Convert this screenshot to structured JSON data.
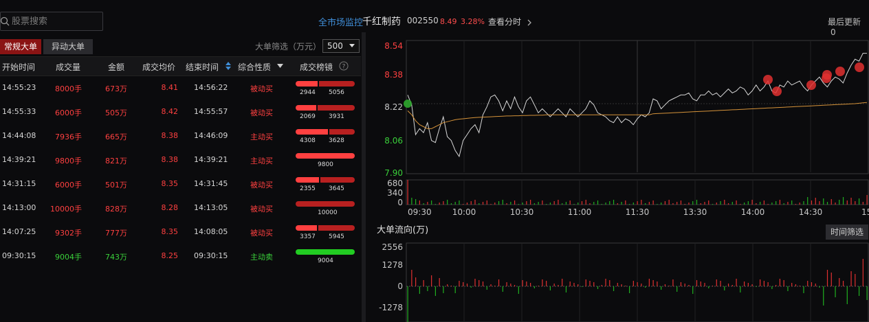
{
  "search": {
    "placeholder": "股票搜索"
  },
  "header": {
    "market_monitor": "全市场监控",
    "stock_name": "千红制药",
    "stock_code": "002550",
    "price": "8.49",
    "change_pct": "3.28%",
    "view_timeshare": "查看分时",
    "last_update_label": "最后更新",
    "last_update_value": "0"
  },
  "tabs": [
    {
      "label": "常规大单"
    },
    {
      "label": "异动大单"
    }
  ],
  "filter": {
    "label": "大单筛选（万元）",
    "value": "500"
  },
  "table": {
    "headers": [
      "开始时间",
      "成交量",
      "金额",
      "成交均价",
      "结束时间",
      "综合性质",
      "成交榜镜"
    ],
    "rows": [
      {
        "start": "14:55:23",
        "vol": "8000手",
        "amt": "673万",
        "avg": "8.41",
        "end": "14:56:22",
        "nature": "被动买",
        "buy": 2944,
        "sell": 5056,
        "buy_label": "2944",
        "sell_label": "5056",
        "dir": "buy"
      },
      {
        "start": "14:55:33",
        "vol": "6000手",
        "amt": "505万",
        "avg": "8.42",
        "end": "14:55:57",
        "nature": "被动买",
        "buy": 2069,
        "sell": 3931,
        "buy_label": "2069",
        "sell_label": "3931",
        "dir": "buy"
      },
      {
        "start": "14:44:08",
        "vol": "7936手",
        "amt": "665万",
        "avg": "8.38",
        "end": "14:46:09",
        "nature": "主动买",
        "buy": 4308,
        "sell": 3628,
        "buy_label": "4308",
        "sell_label": "3628",
        "dir": "buy"
      },
      {
        "start": "14:39:21",
        "vol": "9800手",
        "amt": "821万",
        "avg": "8.38",
        "end": "14:39:21",
        "nature": "主动买",
        "buy": 9800,
        "sell": 0,
        "buy_label": "9800",
        "sell_label": "",
        "dir": "buy"
      },
      {
        "start": "14:31:15",
        "vol": "6000手",
        "amt": "501万",
        "avg": "8.35",
        "end": "14:31:45",
        "nature": "被动买",
        "buy": 2355,
        "sell": 3645,
        "buy_label": "2355",
        "sell_label": "3645",
        "dir": "buy"
      },
      {
        "start": "14:13:00",
        "vol": "10000手",
        "amt": "828万",
        "avg": "8.28",
        "end": "14:13:05",
        "nature": "被动买",
        "buy": 0,
        "sell": 10000,
        "buy_label": "",
        "sell_label": "10000",
        "dir": "buy"
      },
      {
        "start": "14:07:25",
        "vol": "9302手",
        "amt": "777万",
        "avg": "8.35",
        "end": "14:08:05",
        "nature": "被动买",
        "buy": 3357,
        "sell": 5945,
        "buy_label": "3357",
        "sell_label": "5945",
        "dir": "buy"
      },
      {
        "start": "09:30:15",
        "vol": "9004手",
        "amt": "743万",
        "avg": "8.25",
        "end": "09:30:15",
        "nature": "主动卖",
        "buy": 9004,
        "sell": 0,
        "buy_label": "9004",
        "sell_label": "",
        "dir": "sell"
      }
    ]
  },
  "price_chart": {
    "y_ticks": [
      "8.54",
      "8.38",
      "8.22",
      "8.06",
      "7.90"
    ],
    "y_colors": [
      "#ff4040",
      "#ff4040",
      "#c8c8c8",
      "#3ad13a",
      "#3ad13a"
    ],
    "price_series": [
      8.29,
      8.24,
      8.09,
      8.12,
      8.1,
      8.15,
      8.06,
      8.05,
      8.12,
      8.18,
      8.08,
      8.06,
      8.01,
      7.98,
      8.06,
      8.09,
      8.12,
      8.14,
      8.1,
      8.19,
      8.23,
      8.28,
      8.29,
      8.26,
      8.21,
      8.26,
      8.22,
      8.28,
      8.23,
      8.2,
      8.26,
      8.28,
      8.24,
      8.2,
      8.22,
      8.2,
      8.18,
      8.2,
      8.22,
      8.2,
      8.18,
      8.22,
      8.2,
      8.18,
      8.2,
      8.22,
      8.26,
      8.24,
      8.2,
      8.19,
      8.18,
      8.16,
      8.15,
      8.18,
      8.15,
      8.17,
      8.16,
      8.14,
      8.17,
      8.19,
      8.18,
      8.2,
      8.27,
      8.26,
      8.22,
      8.24,
      8.26,
      8.27,
      8.28,
      8.29,
      8.29,
      8.3,
      8.27,
      8.26,
      8.29,
      8.29,
      8.31,
      8.29,
      8.3,
      8.28,
      8.3,
      8.32,
      8.3,
      8.31,
      8.33,
      8.32,
      8.29,
      8.31,
      8.34,
      8.31,
      8.33,
      8.36,
      8.31,
      8.3,
      8.34,
      8.33,
      8.36,
      8.34,
      8.35,
      8.36,
      8.33,
      8.31,
      8.34,
      8.36,
      8.38,
      8.35,
      8.33,
      8.36,
      8.38,
      8.37,
      8.35,
      8.4,
      8.44,
      8.47,
      8.46,
      8.5,
      8.5
    ],
    "avg_series": [
      8.21,
      8.19,
      8.16,
      8.14,
      8.13,
      8.12,
      8.12,
      8.13,
      8.14,
      8.15,
      8.155,
      8.16,
      8.165,
      8.168,
      8.17,
      8.172,
      8.174,
      8.176,
      8.177,
      8.178,
      8.179,
      8.18,
      8.181,
      8.182,
      8.183,
      8.184,
      8.184,
      8.185,
      8.185,
      8.186,
      8.186,
      8.187,
      8.187,
      8.188,
      8.188,
      8.19,
      8.19,
      8.19,
      8.19,
      8.19,
      8.19,
      8.19,
      8.19,
      8.19,
      8.19,
      8.19,
      8.19,
      8.19,
      8.19,
      8.19,
      8.19,
      8.19,
      8.19,
      8.19,
      8.19,
      8.19,
      8.19,
      8.19,
      8.19,
      8.19,
      8.19,
      8.19,
      8.195,
      8.196,
      8.197,
      8.198,
      8.199,
      8.2,
      8.201,
      8.202,
      8.203,
      8.204,
      8.205,
      8.206,
      8.207,
      8.208,
      8.209,
      8.21,
      8.211,
      8.212,
      8.213,
      8.214,
      8.215,
      8.216,
      8.217,
      8.218,
      8.219,
      8.22,
      8.221,
      8.222,
      8.223,
      8.224,
      8.225,
      8.226,
      8.227,
      8.228,
      8.229,
      8.23,
      8.231,
      8.232,
      8.233,
      8.234,
      8.235,
      8.236,
      8.237,
      8.238,
      8.239,
      8.24,
      8.241,
      8.242,
      8.243,
      8.244,
      8.245,
      8.246,
      8.248,
      8.25,
      8.252
    ],
    "ymin": 7.9,
    "ymax": 8.54
  },
  "volume_chart": {
    "y_ticks": [
      "680",
      "340",
      "0"
    ],
    "x_ticks": [
      "09:30",
      "10:00",
      "10:30",
      "11:00",
      "11:30",
      "13:30",
      "14:00",
      "14:30",
      "15:"
    ]
  },
  "flow_chart": {
    "title": "大单流向(万)",
    "y_ticks": [
      "2556",
      "1278",
      "0",
      "-1278"
    ],
    "time_filter": "时间筛选"
  }
}
